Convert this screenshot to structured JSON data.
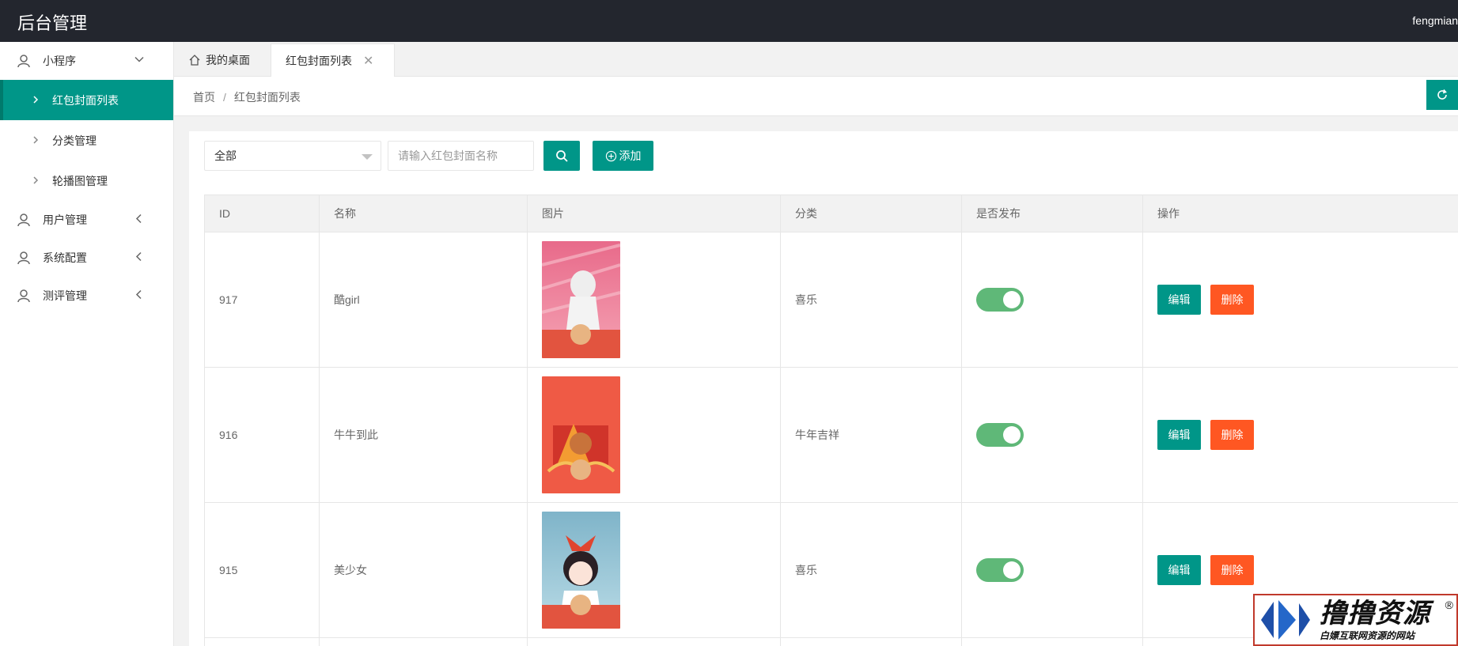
{
  "app": {
    "title": "后台管理",
    "user": "fengmian"
  },
  "sidebar": {
    "groups": [
      {
        "label": "小程序"
      },
      {
        "label": "用户管理"
      },
      {
        "label": "系统配置"
      },
      {
        "label": "测评管理"
      }
    ],
    "subitems": [
      {
        "label": "红包封面列表",
        "active": true
      },
      {
        "label": "分类管理"
      },
      {
        "label": "轮播图管理"
      }
    ]
  },
  "tabs": [
    {
      "label": "我的桌面"
    },
    {
      "label": "红包封面列表"
    }
  ],
  "breadcrumb": {
    "home": "首页",
    "separator": "/",
    "current": "红包封面列表"
  },
  "filters": {
    "category_selected": "全部",
    "search_placeholder": "请输入红包封面名称",
    "add_label": "添加"
  },
  "table": {
    "headers": [
      "ID",
      "名称",
      "图片",
      "分类",
      "是否发布",
      "操作"
    ],
    "rows": [
      {
        "id": "917",
        "name": "酷girl",
        "category": "喜乐",
        "published": true,
        "image_badge": "開"
      },
      {
        "id": "916",
        "name": "牛牛到此",
        "category": "牛年吉祥",
        "published": true,
        "image_badge": "開"
      },
      {
        "id": "915",
        "name": "美少女",
        "category": "喜乐",
        "published": true,
        "image_badge": "開"
      }
    ],
    "edit_label": "编辑",
    "delete_label": "删除"
  },
  "watermark": {
    "title": "撸撸资源",
    "subtitle": "白嫖互联网资源的网站",
    "reg": "®"
  },
  "colors": {
    "primary": "#009688",
    "danger": "#ff5722",
    "switch_on": "#5fb878",
    "header_bg": "#23262e"
  }
}
